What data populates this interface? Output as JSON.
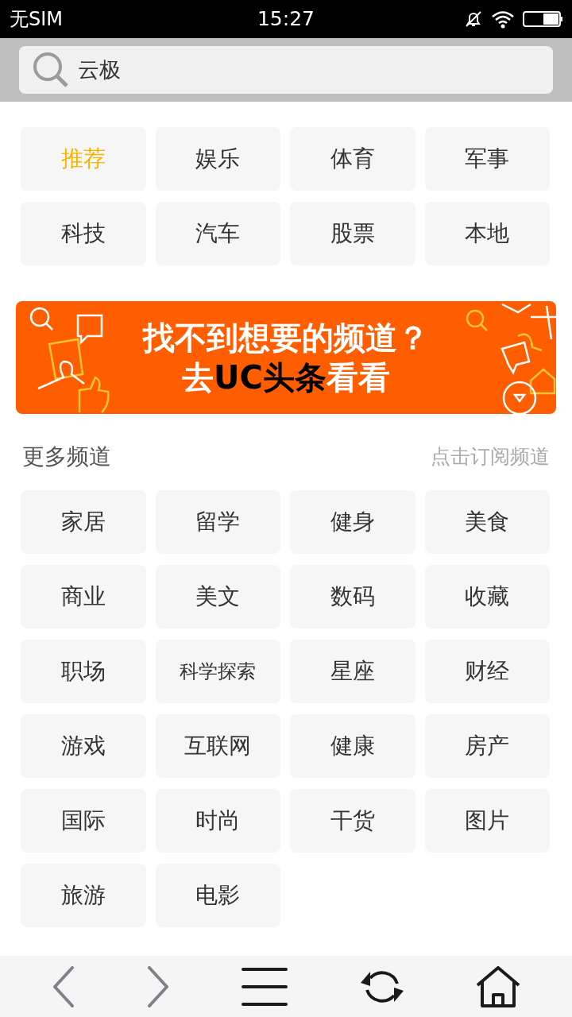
{
  "status_bar": {
    "carrier": "无SIM",
    "time": "15:27"
  },
  "search": {
    "value": "云极"
  },
  "my_channels": [
    {
      "label": "推荐",
      "selected": true
    },
    {
      "label": "娱乐",
      "selected": false
    },
    {
      "label": "体育",
      "selected": false
    },
    {
      "label": "军事",
      "selected": false
    },
    {
      "label": "科技",
      "selected": false
    },
    {
      "label": "汽车",
      "selected": false
    },
    {
      "label": "股票",
      "selected": false
    },
    {
      "label": "本地",
      "selected": false
    }
  ],
  "banner": {
    "line1": "找不到想要的频道？",
    "line2_before": "去",
    "line2_highlight": "UC头条",
    "line2_after": "看看"
  },
  "more_channels": {
    "title": "更多频道",
    "hint": "点击订阅频道",
    "items": [
      "家居",
      "留学",
      "健身",
      "美食",
      "商业",
      "美文",
      "数码",
      "收藏",
      "职场",
      "科学探索",
      "星座",
      "财经",
      "游戏",
      "互联网",
      "健康",
      "房产",
      "国际",
      "时尚",
      "干货",
      "图片",
      "旅游",
      "电影"
    ]
  },
  "nav": [
    {
      "kind": "back",
      "disabled": true
    },
    {
      "kind": "forward",
      "disabled": true
    },
    {
      "kind": "menu",
      "disabled": false
    },
    {
      "kind": "refresh",
      "disabled": false
    },
    {
      "kind": "home",
      "disabled": false
    }
  ]
}
